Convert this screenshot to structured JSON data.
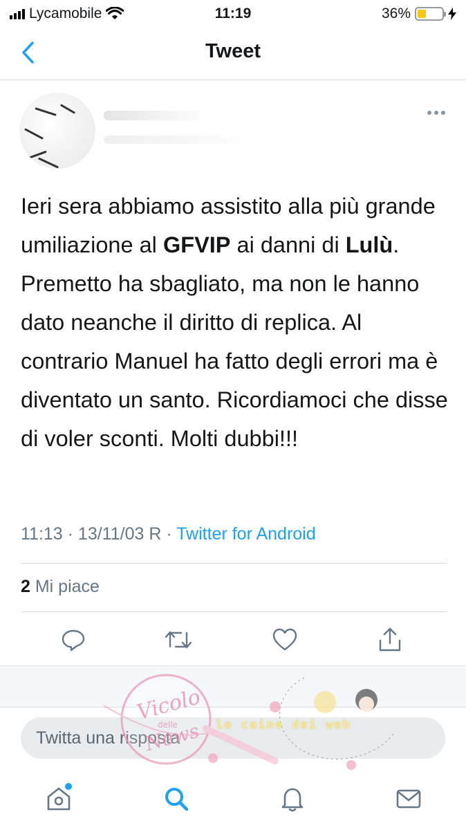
{
  "status_bar": {
    "carrier": "Lycamobile",
    "time": "11:19",
    "battery_percent": "36%",
    "battery_level": 0.36
  },
  "nav": {
    "title": "Tweet",
    "back_icon": "chevron-left-icon"
  },
  "tweet": {
    "text_segments": {
      "s1": "Ieri sera abbiamo assistito alla più grande umiliazione al ",
      "b1": "GFVIP",
      "s2": " ai danni di ",
      "b2": "Lulù",
      "s3": ". Premetto ha sbagliato, ma non le hanno dato neanche il diritto di replica. Al contrario  Manuel ha fatto degli errori ma è diventato un santo. Ricordiamoci che disse di voler sconti. Molti dubbi!!!"
    },
    "timestamp": "11:13 · 13/11/03 R · ",
    "source": "Twitter for Android",
    "likes_count": "2",
    "likes_label": " Mi piace"
  },
  "actions": [
    "reply-icon",
    "retweet-icon",
    "like-icon",
    "share-icon"
  ],
  "reply": {
    "placeholder": "Twitta una risposta"
  },
  "tabbar": [
    "home-icon",
    "search-icon",
    "notifications-icon",
    "messages-icon"
  ],
  "watermark": {
    "logo_text": "Vicolo delle News",
    "banner_text": "le caine dei web"
  },
  "colors": {
    "accent": "#1da1f2",
    "meta_grey": "#657786",
    "icon_grey": "#657786"
  }
}
